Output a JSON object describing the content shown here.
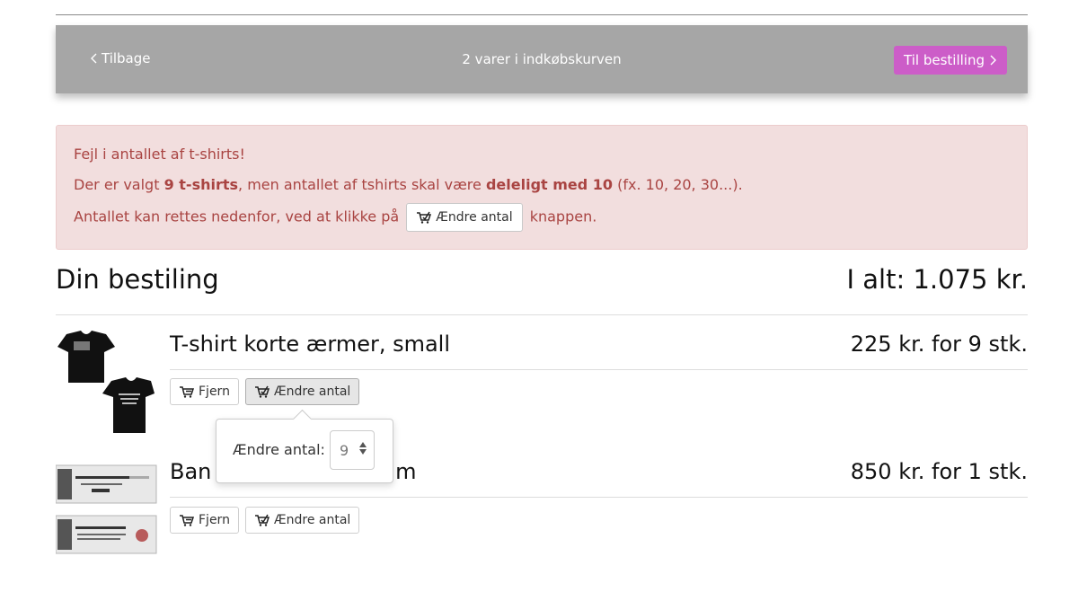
{
  "navbar": {
    "back_label": "Tilbage",
    "cart_count_text": "2 varer i indkøbskurven",
    "checkout_label": "Til bestilling"
  },
  "alert": {
    "title": "Fejl i antallet af t-shirts!",
    "line2_pre": "Der er valgt ",
    "line2_bold1": "9 t-shirts",
    "line2_mid": ", men antallet af tshirts skal være ",
    "line2_bold2": "deleligt med 10",
    "line2_post": " (fx. 10, 20, 30...).",
    "line3_pre": "Antallet kan rettes nedenfor, ved at klikke på",
    "line3_button": "Ændre antal",
    "line3_post": "knappen.",
    "color": "#a94442",
    "background": "#f2dede"
  },
  "order": {
    "title": "Din bestiling",
    "total": "I alt: 1.075 kr."
  },
  "items": [
    {
      "title": "T-shirt korte ærmer, small",
      "price": "225 kr. for 9 stk.",
      "remove_label": "Fjern",
      "change_label": "Ændre antal"
    },
    {
      "title_start": "Ban",
      "title_end": "x 6 m",
      "price": "850 kr. for 1 stk.",
      "remove_label": "Fjern",
      "change_label": "Ændre antal"
    }
  ],
  "popover": {
    "label": "Ændre antal:",
    "quantity_value": "9"
  },
  "icons": {
    "back": "chevron-left-icon",
    "forward": "chevron-right-icon",
    "remove": "cart-remove-icon",
    "change": "cart-change-icon"
  },
  "colors": {
    "navbar": "#a6a6a6",
    "primary_button": "#cc5dc8"
  }
}
